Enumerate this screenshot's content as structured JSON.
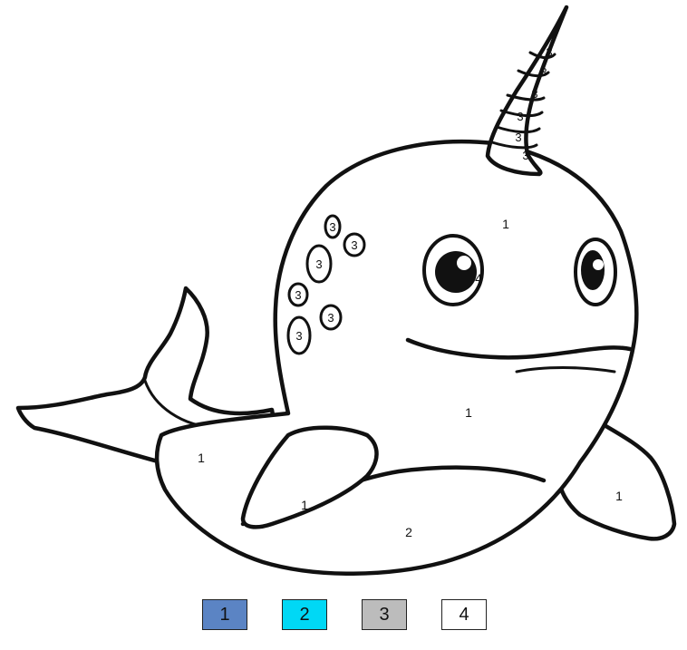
{
  "regions": {
    "body_top": "1",
    "body_middle": "1",
    "tail": "1",
    "front_fin": "1",
    "back_fin": "1",
    "belly": "2",
    "eye": "4",
    "horn": [
      "3",
      "3",
      "3",
      "3",
      "3",
      "3"
    ],
    "spots": [
      "3",
      "3",
      "3",
      "3",
      "3",
      "3"
    ]
  },
  "legend": [
    {
      "label": "1",
      "color": "#5b84c4"
    },
    {
      "label": "2",
      "color": "#00d8f5"
    },
    {
      "label": "3",
      "color": "#bcbcbc"
    },
    {
      "label": "4",
      "color": "#ffffff"
    }
  ]
}
